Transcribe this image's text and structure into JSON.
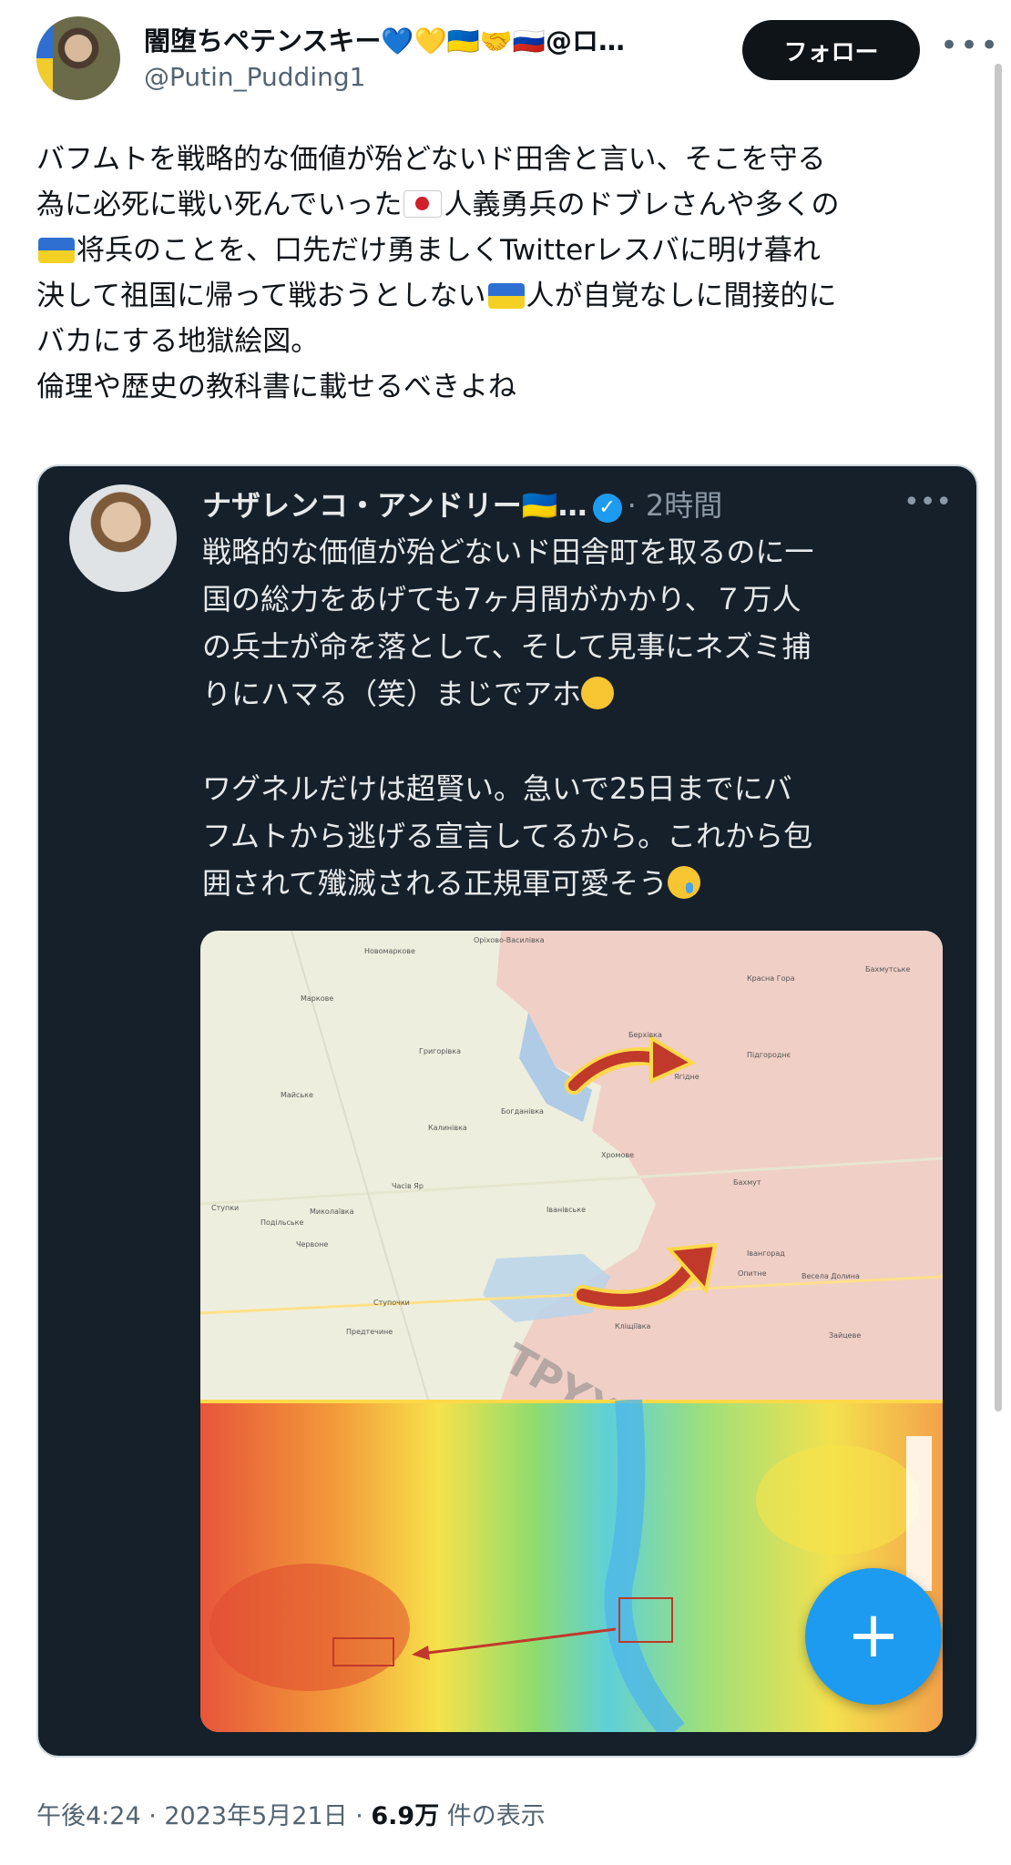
{
  "author": {
    "display_name": "闇堕ちペテンスキー💙💛🇺🇦🤝🇷🇺@ロ…",
    "handle": "@Putin_Pudding1",
    "follow_label": "フォロー"
  },
  "tweet": {
    "line1": "バフムトを戦略的な価値が殆どないド田舎と言い、そこを守る",
    "line2a": "為に必死に戦い死んでいった",
    "line2b": "人義勇兵のドブレさんや多くの",
    "line3": "将兵のことを、口先だけ勇ましくTwitterレスバに明け暮れ",
    "line4a": "決して祖国に帰って戦おうとしない",
    "line4b": "人が自覚なしに間接的に",
    "line5": "バカにする地獄絵図。",
    "line6": "倫理や歴史の教科書に載せるべきよね"
  },
  "quoted": {
    "name": "ナザレンコ・アンドリー🇺🇦…",
    "time": "· 2時間",
    "text1": "戦略的な価値が殆どないド田舎町を取るのに一",
    "text2": "国の総力をあげても7ヶ月間がかかり、７万人",
    "text3": "の兵士が命を落として、そして見事にネズミ捕",
    "text4": "りにハマる（笑）まじでアホ",
    "text5": "ワグネルだけは超賢い。急いで25日までにバ",
    "text6": "フムトから逃げる宣言してるから。これから包",
    "text7": "囲されて殲滅される正規軍可愛そう",
    "map_labels": [
      "Новомаркове",
      "Орiхово-Василiвка",
      "Красна Гора",
      "Бахмутське",
      "Маркове",
      "Григорiвка",
      "Берхiвка",
      "Пiдгороднє",
      "Майське",
      "Богданiвка",
      "Ягiдне",
      "Калинiвка",
      "Хромове",
      "Бахмут",
      "Часiв Яр",
      "Ступки",
      "Миколаївка",
      "Iванiвське",
      "Подiльське",
      "Червоне",
      "Iвангорад",
      "Опитне",
      "Весела Долина",
      "Ступочки",
      "Предтечине",
      "Клiщiївка",
      "Зайцеве",
      "TPYXA"
    ]
  },
  "fab_label": "+",
  "meta": {
    "time": "午後4:24 · 2023年5月21日 · ",
    "views": "6.9万",
    "views_label": " 件の表示"
  }
}
